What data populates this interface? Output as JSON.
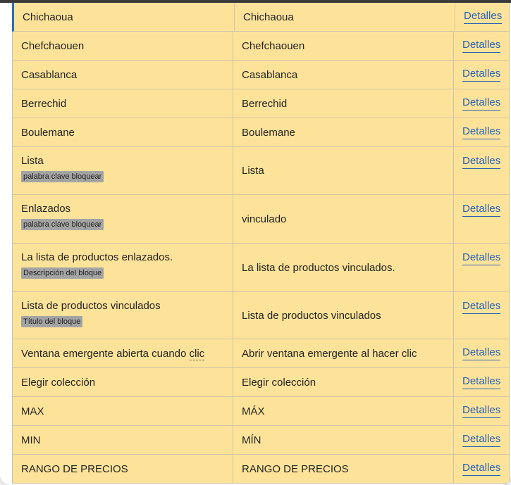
{
  "rows": [
    {
      "source": "Chichaoua",
      "translation": "Chichaoua",
      "action": "Detalles",
      "tag": null
    },
    {
      "source": "Chefchaouen",
      "translation": "Chefchaouen",
      "action": "Detalles",
      "tag": null
    },
    {
      "source": "Casablanca",
      "translation": "Casablanca",
      "action": "Detalles",
      "tag": null
    },
    {
      "source": "Berrechid",
      "translation": "Berrechid",
      "action": "Detalles",
      "tag": null
    },
    {
      "source": "Boulemane",
      "translation": "Boulemane",
      "action": "Detalles",
      "tag": null
    },
    {
      "source": "Lista",
      "translation": "Lista",
      "action": "Detalles",
      "tag": "palabra clave bloquear"
    },
    {
      "source": "Enlazados",
      "translation": "vinculado",
      "action": "Detalles",
      "tag": "palabra clave bloquear"
    },
    {
      "source": "La lista de productos enlazados.",
      "translation": "La lista de productos vinculados.",
      "action": "Detalles",
      "tag": "Descripción del bloque"
    },
    {
      "source": "Lista de productos vinculados",
      "translation": "Lista de productos vinculados",
      "action": "Detalles",
      "tag": "Título del bloque"
    },
    {
      "source_prefix": "Ventana emergente abierta cuando ",
      "source_term": "clic",
      "translation": "Abrir ventana emergente al hacer clic",
      "action": "Detalles",
      "tag": null
    },
    {
      "source": "Elegir colección",
      "translation": "Elegir colección",
      "action": "Detalles",
      "tag": null
    },
    {
      "source": "MAX",
      "translation": "MÁX",
      "action": "Detalles",
      "tag": null
    },
    {
      "source": "MIN",
      "translation": "MÍN",
      "action": "Detalles",
      "tag": null
    },
    {
      "source": "RANGO DE PRECIOS",
      "translation": "RANGO DE PRECIOS",
      "action": "Detalles",
      "tag": null
    }
  ],
  "colors": {
    "row_background": "#fde39a",
    "link": "#2a62b5",
    "tag_background": "#a3a3a3",
    "active_row_marker": "#2f6db0"
  }
}
